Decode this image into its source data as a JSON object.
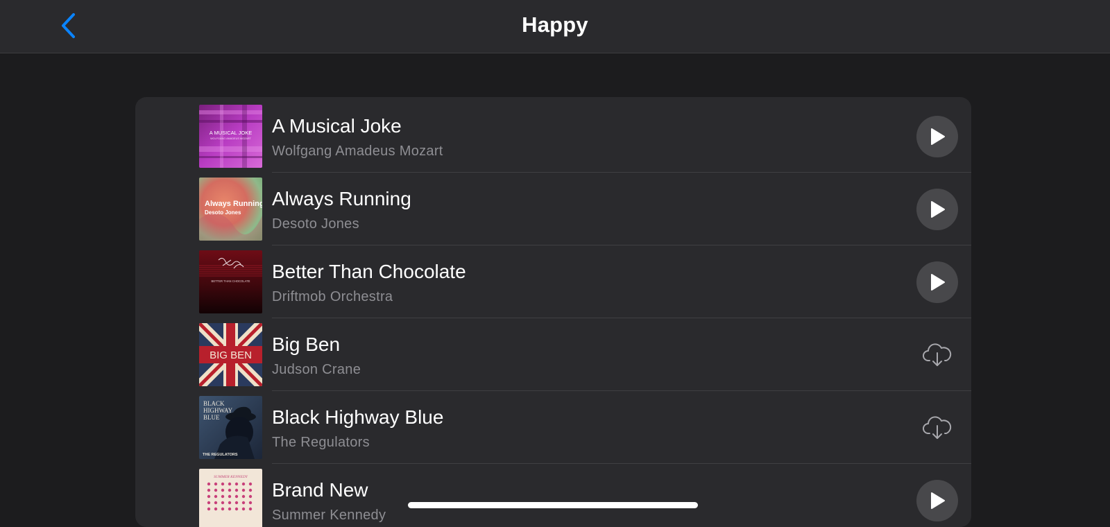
{
  "nav": {
    "title": "Happy",
    "back_icon": "chevron-left-icon",
    "accent": "#0a84ff"
  },
  "songs": [
    {
      "title": "A Musical Joke",
      "artist": "Wolfgang Amadeus Mozart",
      "action": "play",
      "art_text": [
        "A MUSICAL JOKE",
        "WOLFGANG AMADEUS MOZART"
      ]
    },
    {
      "title": "Always Running",
      "artist": "Desoto Jones",
      "action": "play",
      "art_text": [
        "Always Running",
        "Desoto Jones"
      ]
    },
    {
      "title": "Better Than Chocolate",
      "artist": "Driftmob Orchestra",
      "action": "play",
      "art_text": [
        "BETTER THAN CHOCOLATE"
      ]
    },
    {
      "title": "Big Ben",
      "artist": "Judson Crane",
      "action": "download",
      "art_text": [
        "BIG BEN"
      ]
    },
    {
      "title": "Black Highway Blue",
      "artist": "The Regulators",
      "action": "download",
      "art_text": [
        "BLACK",
        "HIGHWAY",
        "BLUE",
        "THE REGULATORS"
      ]
    },
    {
      "title": "Brand New",
      "artist": "Summer Kennedy",
      "action": "play",
      "art_text": [
        "SUMMER KENNEDY"
      ]
    }
  ],
  "icons": {
    "play": "play-icon",
    "download": "cloud-download-icon"
  }
}
